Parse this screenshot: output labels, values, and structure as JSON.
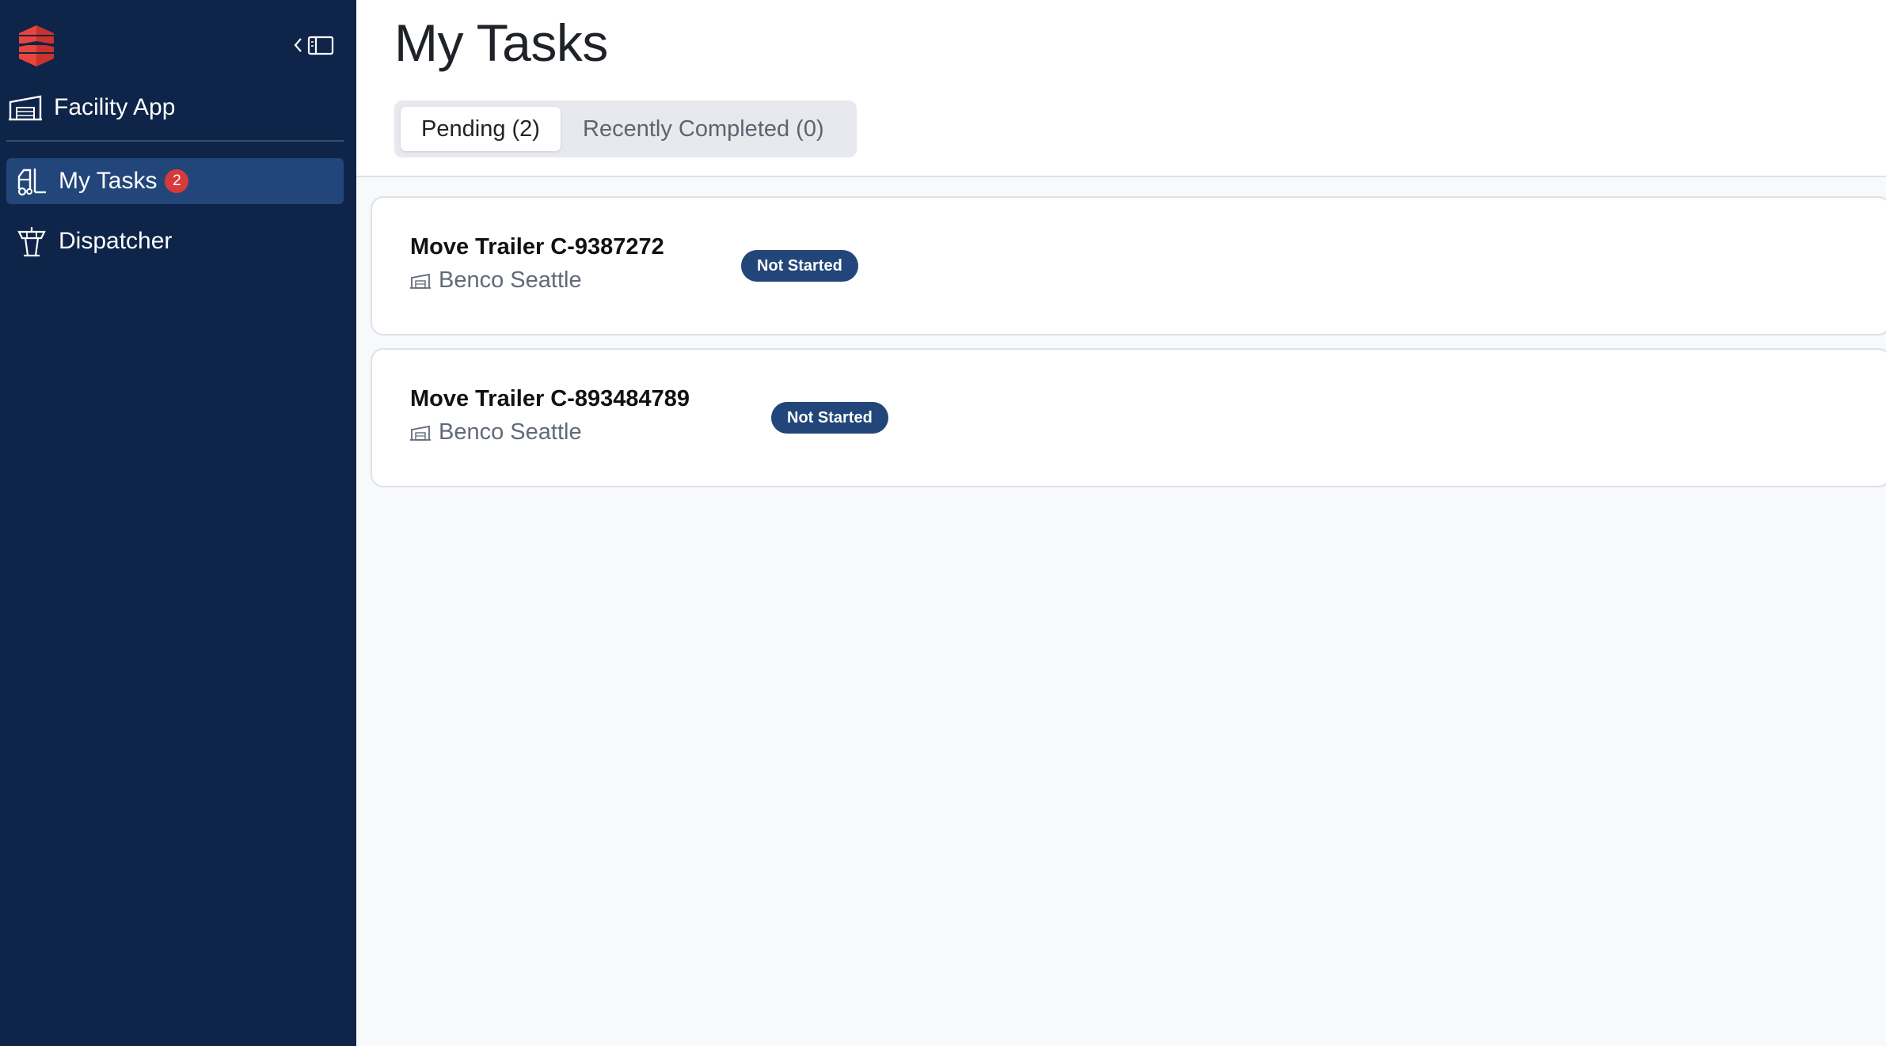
{
  "sidebar": {
    "app_label": "Facility App",
    "items": [
      {
        "label": "My Tasks",
        "badge": "2",
        "active": true,
        "icon": "forklift-icon"
      },
      {
        "label": "Dispatcher",
        "active": false,
        "icon": "control-tower-icon"
      }
    ],
    "icons": {
      "logo": "company-logo",
      "collapse": "collapse-sidebar-icon",
      "app": "warehouse-icon"
    }
  },
  "main": {
    "title": "My Tasks",
    "tabs": [
      {
        "label": "Pending (2)",
        "active": true
      },
      {
        "label": "Recently Completed (0)",
        "active": false
      }
    ],
    "tasks": [
      {
        "title": "Move Trailer C-9387272",
        "location": "Benco Seattle",
        "status": "Not Started"
      },
      {
        "title": "Move Trailer C-893484789",
        "location": "Benco Seattle",
        "status": "Not Started"
      }
    ]
  },
  "colors": {
    "sidebar_bg": "#0f2449",
    "active_nav": "#22467a",
    "badge": "#d73a3a",
    "status_pill": "#22467a",
    "logo": "#e8453c"
  }
}
